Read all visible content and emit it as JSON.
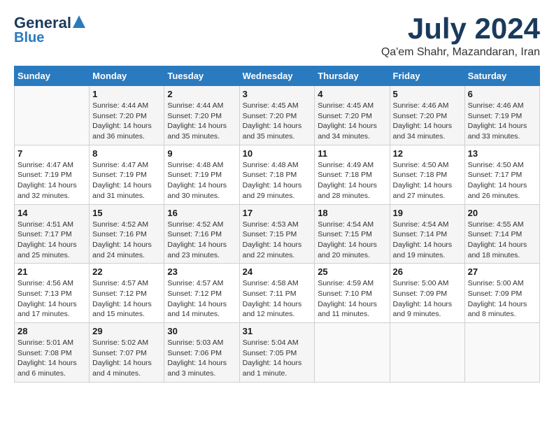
{
  "header": {
    "logo_line1": "General",
    "logo_line2": "Blue",
    "title": "July 2024",
    "subtitle": "Qa'em Shahr, Mazandaran, Iran"
  },
  "calendar": {
    "days_of_week": [
      "Sunday",
      "Monday",
      "Tuesday",
      "Wednesday",
      "Thursday",
      "Friday",
      "Saturday"
    ],
    "weeks": [
      [
        {
          "num": "",
          "info": ""
        },
        {
          "num": "1",
          "info": "Sunrise: 4:44 AM\nSunset: 7:20 PM\nDaylight: 14 hours\nand 36 minutes."
        },
        {
          "num": "2",
          "info": "Sunrise: 4:44 AM\nSunset: 7:20 PM\nDaylight: 14 hours\nand 35 minutes."
        },
        {
          "num": "3",
          "info": "Sunrise: 4:45 AM\nSunset: 7:20 PM\nDaylight: 14 hours\nand 35 minutes."
        },
        {
          "num": "4",
          "info": "Sunrise: 4:45 AM\nSunset: 7:20 PM\nDaylight: 14 hours\nand 34 minutes."
        },
        {
          "num": "5",
          "info": "Sunrise: 4:46 AM\nSunset: 7:20 PM\nDaylight: 14 hours\nand 34 minutes."
        },
        {
          "num": "6",
          "info": "Sunrise: 4:46 AM\nSunset: 7:19 PM\nDaylight: 14 hours\nand 33 minutes."
        }
      ],
      [
        {
          "num": "7",
          "info": "Sunrise: 4:47 AM\nSunset: 7:19 PM\nDaylight: 14 hours\nand 32 minutes."
        },
        {
          "num": "8",
          "info": "Sunrise: 4:47 AM\nSunset: 7:19 PM\nDaylight: 14 hours\nand 31 minutes."
        },
        {
          "num": "9",
          "info": "Sunrise: 4:48 AM\nSunset: 7:19 PM\nDaylight: 14 hours\nand 30 minutes."
        },
        {
          "num": "10",
          "info": "Sunrise: 4:48 AM\nSunset: 7:18 PM\nDaylight: 14 hours\nand 29 minutes."
        },
        {
          "num": "11",
          "info": "Sunrise: 4:49 AM\nSunset: 7:18 PM\nDaylight: 14 hours\nand 28 minutes."
        },
        {
          "num": "12",
          "info": "Sunrise: 4:50 AM\nSunset: 7:18 PM\nDaylight: 14 hours\nand 27 minutes."
        },
        {
          "num": "13",
          "info": "Sunrise: 4:50 AM\nSunset: 7:17 PM\nDaylight: 14 hours\nand 26 minutes."
        }
      ],
      [
        {
          "num": "14",
          "info": "Sunrise: 4:51 AM\nSunset: 7:17 PM\nDaylight: 14 hours\nand 25 minutes."
        },
        {
          "num": "15",
          "info": "Sunrise: 4:52 AM\nSunset: 7:16 PM\nDaylight: 14 hours\nand 24 minutes."
        },
        {
          "num": "16",
          "info": "Sunrise: 4:52 AM\nSunset: 7:16 PM\nDaylight: 14 hours\nand 23 minutes."
        },
        {
          "num": "17",
          "info": "Sunrise: 4:53 AM\nSunset: 7:15 PM\nDaylight: 14 hours\nand 22 minutes."
        },
        {
          "num": "18",
          "info": "Sunrise: 4:54 AM\nSunset: 7:15 PM\nDaylight: 14 hours\nand 20 minutes."
        },
        {
          "num": "19",
          "info": "Sunrise: 4:54 AM\nSunset: 7:14 PM\nDaylight: 14 hours\nand 19 minutes."
        },
        {
          "num": "20",
          "info": "Sunrise: 4:55 AM\nSunset: 7:14 PM\nDaylight: 14 hours\nand 18 minutes."
        }
      ],
      [
        {
          "num": "21",
          "info": "Sunrise: 4:56 AM\nSunset: 7:13 PM\nDaylight: 14 hours\nand 17 minutes."
        },
        {
          "num": "22",
          "info": "Sunrise: 4:57 AM\nSunset: 7:12 PM\nDaylight: 14 hours\nand 15 minutes."
        },
        {
          "num": "23",
          "info": "Sunrise: 4:57 AM\nSunset: 7:12 PM\nDaylight: 14 hours\nand 14 minutes."
        },
        {
          "num": "24",
          "info": "Sunrise: 4:58 AM\nSunset: 7:11 PM\nDaylight: 14 hours\nand 12 minutes."
        },
        {
          "num": "25",
          "info": "Sunrise: 4:59 AM\nSunset: 7:10 PM\nDaylight: 14 hours\nand 11 minutes."
        },
        {
          "num": "26",
          "info": "Sunrise: 5:00 AM\nSunset: 7:09 PM\nDaylight: 14 hours\nand 9 minutes."
        },
        {
          "num": "27",
          "info": "Sunrise: 5:00 AM\nSunset: 7:09 PM\nDaylight: 14 hours\nand 8 minutes."
        }
      ],
      [
        {
          "num": "28",
          "info": "Sunrise: 5:01 AM\nSunset: 7:08 PM\nDaylight: 14 hours\nand 6 minutes."
        },
        {
          "num": "29",
          "info": "Sunrise: 5:02 AM\nSunset: 7:07 PM\nDaylight: 14 hours\nand 4 minutes."
        },
        {
          "num": "30",
          "info": "Sunrise: 5:03 AM\nSunset: 7:06 PM\nDaylight: 14 hours\nand 3 minutes."
        },
        {
          "num": "31",
          "info": "Sunrise: 5:04 AM\nSunset: 7:05 PM\nDaylight: 14 hours\nand 1 minute."
        },
        {
          "num": "",
          "info": ""
        },
        {
          "num": "",
          "info": ""
        },
        {
          "num": "",
          "info": ""
        }
      ]
    ]
  }
}
